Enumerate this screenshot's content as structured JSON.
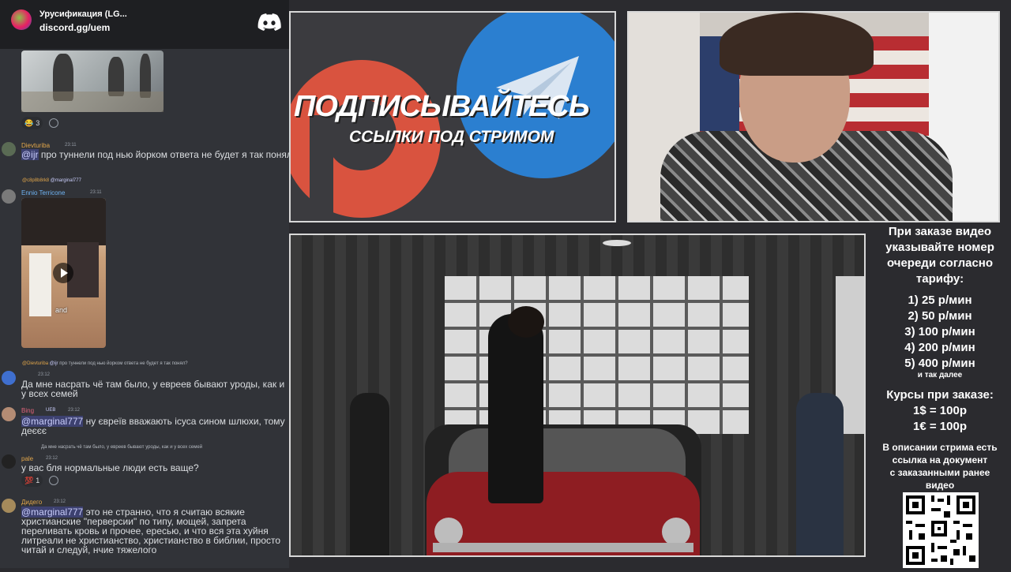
{
  "discord_header": {
    "server_name": "Урусификация (LG...",
    "invite": "discord.gg/uem"
  },
  "messages": [
    {
      "reactions": [
        {
          "emoji": "😂",
          "count": "3"
        }
      ]
    },
    {
      "user": "Dievturiba",
      "time": "23:11",
      "mention": "@ijr",
      "text": " про туннели под нью йорком ответа не будет я так понял?"
    },
    {
      "reply_to": "@c8p8b8rk8",
      "reply_mention": "@marginal777",
      "user": "Ennio Terricone",
      "time": "23:11",
      "video_caption": "and"
    },
    {
      "reply_to": "@Dievturiba",
      "reply_mention": "@ijr",
      "reply_text": "про туннели под нью йорком ответа не будет я так понял?",
      "time": "23:12",
      "text": "Да мне насрать чё там было, у евреев бывают уроды, как и у всех семей"
    },
    {
      "user": "Bing",
      "tag": "UEB",
      "time": "23:12",
      "mention": "@marginal777",
      "text": " ну євреїв вважають ісуса сином шлюхи, тому деєєє"
    },
    {
      "reply_text": "Да мне насрать чё там было, у евреев бывают уроды, как и у всех семей",
      "user": "pale",
      "time": "23:12",
      "text": "у вас бля нормальные люди есть ваще?",
      "reactions": [
        {
          "emoji": "💯",
          "count": "1"
        }
      ]
    },
    {
      "user": "Дидего",
      "time": "23:12",
      "mention": "@marginal777",
      "text": " это не странно, что я считаю всякие христианские \"перверсии\" по типу, мощей, запрета переливать кровь и прочее, ересью, и что вся эта хуйня литреали не христианство, христианство в библии, просто читай и следуй, нчие тяжелого"
    }
  ],
  "overlay": {
    "subscribe": "ПОДПИСЫВАЙТЕСЬ",
    "links": "ССЫЛКИ ПОД СТРИМОМ"
  },
  "info": {
    "order_lines": [
      "При заказе видео",
      "указывайте номер",
      "очереди согласно",
      "тарифу:"
    ],
    "tariffs": [
      "1) 25 р/мин",
      "2) 50 р/мин",
      "3) 100 р/мин",
      "4) 200 р/мин",
      "5) 400 р/мин"
    ],
    "etc": "и так далее",
    "rates_title": "Курсы при заказе:",
    "rates": [
      "1$ = 100р",
      "1€ = 100р"
    ],
    "desc_lines": [
      "В описании стрима есть",
      "ссылка на документ",
      "с заказанными ранее",
      "видео"
    ]
  },
  "colors": {
    "discord_bg": "#313338",
    "mention": "#c9cdfb",
    "telegram_blue": "#2b7fd0",
    "patreon_red": "#d9533f"
  }
}
